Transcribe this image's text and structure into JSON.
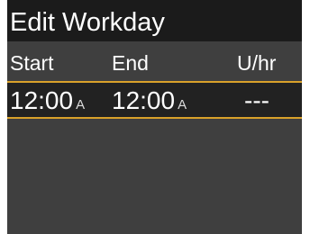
{
  "screen": {
    "title": "Edit Workday"
  },
  "columns": {
    "start": "Start",
    "end": "End",
    "rate": "U/hr"
  },
  "rows": [
    {
      "start_time": "12:00",
      "start_ampm": "A",
      "end_time": "12:00",
      "end_ampm": "A",
      "rate": "---"
    }
  ],
  "colors": {
    "background": "#3f3f3f",
    "title_bar": "#1b1b1b",
    "selected_row": "#222222",
    "highlight_border": "#d9a12a",
    "text": "#ffffff"
  }
}
